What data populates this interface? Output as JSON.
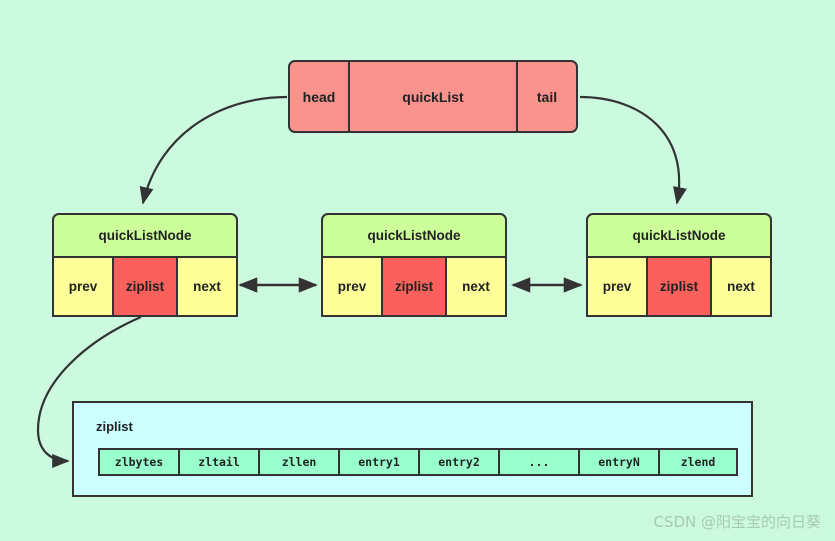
{
  "diagram": {
    "background_color": "#ccfadf",
    "quicklist": {
      "head_label": "head",
      "body_label": "quickList",
      "tail_label": "tail",
      "fill_color": "#fa938e"
    },
    "nodes": [
      {
        "title": "quickListNode",
        "prev": "prev",
        "ziplist": "ziplist",
        "next": "next"
      },
      {
        "title": "quickListNode",
        "prev": "prev",
        "ziplist": "ziplist",
        "next": "next"
      },
      {
        "title": "quickListNode",
        "prev": "prev",
        "ziplist": "ziplist",
        "next": "next"
      }
    ],
    "node_colors": {
      "title_fill": "#ccff99",
      "pointer_fill": "#ffff99",
      "ziplist_fill": "#fa615c",
      "stroke": "#333333"
    },
    "ziplist_panel": {
      "label": "ziplist",
      "fill_color": "#ccffff",
      "cell_fill": "#99ffcc",
      "cells": [
        "zlbytes",
        "zltail",
        "zllen",
        "entry1",
        "entry2",
        "...",
        "entryN",
        "zlend"
      ]
    }
  },
  "watermark": {
    "text": "CSDN @阳宝宝的向日葵",
    "color": "#a8c9b5"
  }
}
